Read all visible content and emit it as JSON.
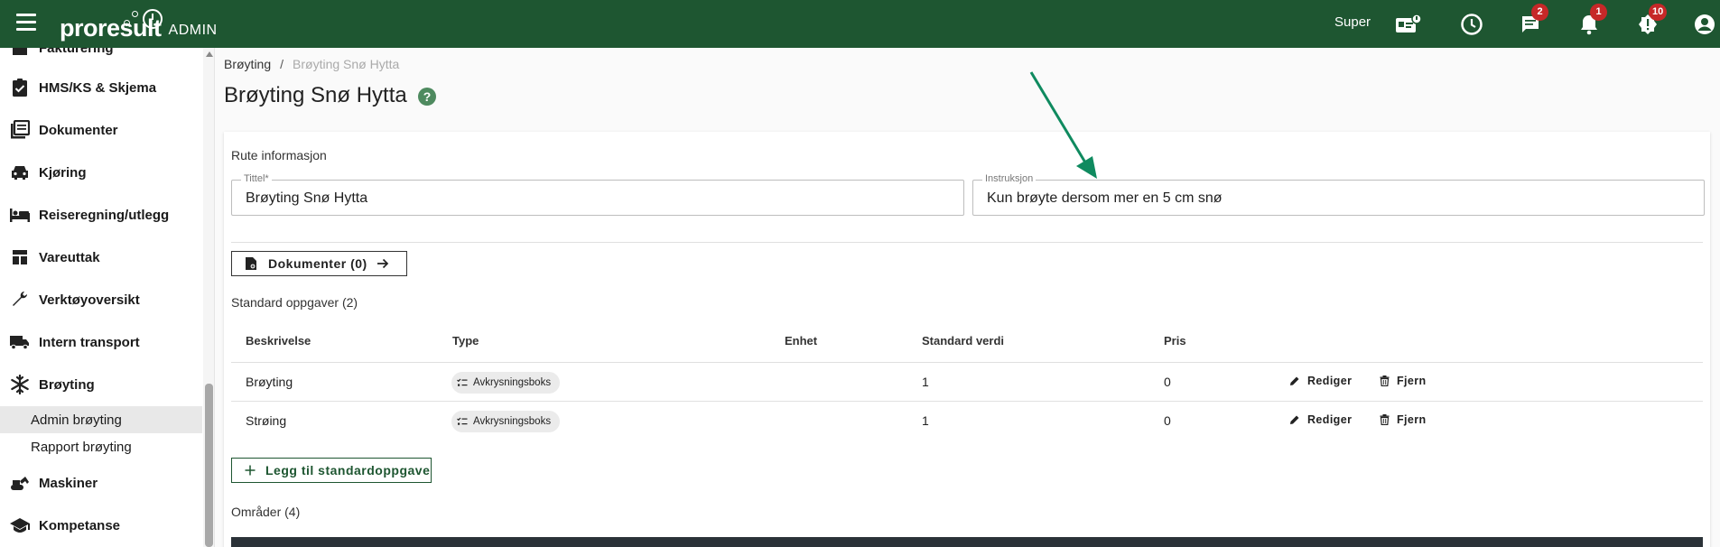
{
  "topbar": {
    "logo_text": "proresult",
    "logo_suffix": "ADMIN",
    "user_name": "Super",
    "badges": {
      "messages": "2",
      "notifications": "1",
      "alerts": "10"
    }
  },
  "sidebar": {
    "items": [
      {
        "label": "Fakturering",
        "icon": "invoice-icon"
      },
      {
        "label": "HMS/KS & Skjema",
        "icon": "clipboard-check-icon"
      },
      {
        "label": "Dokumenter",
        "icon": "documents-icon"
      },
      {
        "label": "Kjøring",
        "icon": "car-icon"
      },
      {
        "label": "Reiseregning/utlegg",
        "icon": "bed-icon"
      },
      {
        "label": "Vareuttak",
        "icon": "dashboard-icon"
      },
      {
        "label": "Verktøyoversikt",
        "icon": "wrench-icon"
      },
      {
        "label": "Intern transport",
        "icon": "truck-icon"
      },
      {
        "label": "Brøyting",
        "icon": "snowflake-icon"
      },
      {
        "label": "Maskiner",
        "icon": "excavator-icon"
      },
      {
        "label": "Kompetanse",
        "icon": "school-icon"
      }
    ],
    "subitems": [
      {
        "label": "Admin brøyting",
        "active": true
      },
      {
        "label": "Rapport brøyting",
        "active": false
      }
    ]
  },
  "breadcrumb": {
    "parent": "Brøyting",
    "separator": "/",
    "current": "Brøyting Snø Hytta"
  },
  "page": {
    "title": "Brøyting Snø Hytta",
    "help": "?"
  },
  "route_info": {
    "heading": "Rute informasjon",
    "title_label": "Tittel*",
    "title_value": "Brøyting Snø Hytta",
    "instruction_label": "Instruksjon",
    "instruction_value": "Kun brøyte dersom mer en 5 cm snø"
  },
  "documents_button": "Dokumenter (0)",
  "standard_tasks": {
    "heading": "Standard oppgaver (2)",
    "columns": [
      "Beskrivelse",
      "Type",
      "Enhet",
      "Standard verdi",
      "Pris"
    ],
    "rows": [
      {
        "description": "Brøyting",
        "type": "Avkrysningsboks",
        "unit": "",
        "default_value": "1",
        "price": "0"
      },
      {
        "description": "Strøing",
        "type": "Avkrysningsboks",
        "unit": "",
        "default_value": "1",
        "price": "0"
      }
    ],
    "edit_label": "Rediger",
    "remove_label": "Fjern",
    "add_button": "Legg til standardoppgave"
  },
  "areas": {
    "heading": "Områder (4)"
  },
  "colors": {
    "brand": "#1e5631",
    "badge": "#c62828",
    "annotation_arrow": "#0f8a5f"
  }
}
